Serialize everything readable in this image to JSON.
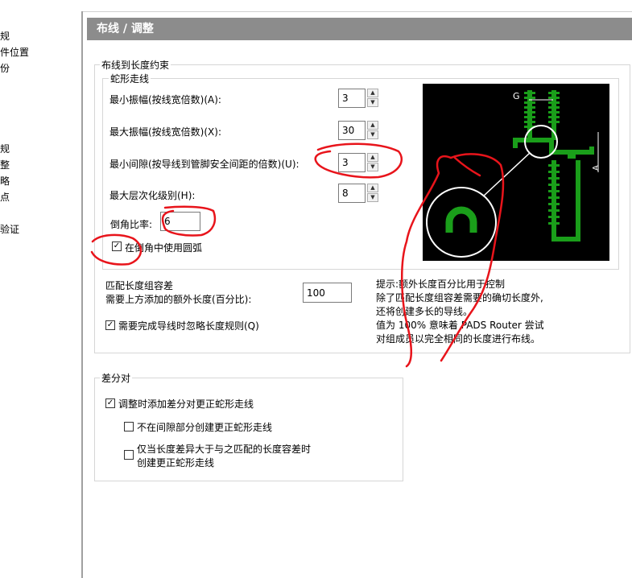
{
  "sidebar": {
    "items": [
      "规",
      "件位置",
      "份",
      "规",
      "整",
      "略",
      "点",
      "验证"
    ]
  },
  "page": {
    "title": "布线 / 调整"
  },
  "length_group": {
    "title": "布线到长度约束",
    "meander": {
      "title": "蛇形走线",
      "min_amplitude_label": "最小振幅(按线宽倍数)(A):",
      "min_amplitude_value": "3",
      "max_amplitude_label": "最大振幅(按线宽倍数)(X):",
      "max_amplitude_value": "30",
      "min_gap_label": "最小间隙(按导线到管脚安全间距的倍数)(U):",
      "min_gap_value": "3",
      "max_level_label": "最大层次化级别(H):",
      "max_level_value": "8",
      "chamfer_label": "倒角比率:",
      "chamfer_value": "6",
      "use_arc_label": "在倒角中使用圆弧",
      "use_arc_checked": true
    },
    "preview": {
      "label_g": "G",
      "label_a": "A"
    },
    "match_tolerance": {
      "line1": "匹配长度组容差",
      "line2": "需要上方添加的额外长度(百分比):",
      "value": "100"
    },
    "hint": {
      "line1": "提示:额外长度百分比用于控制",
      "line2": "除了匹配长度组容差需要的确切长度外,",
      "line3": "还将创建多长的导线。",
      "line4": "值为 100% 意味着 PADS Router 尝试",
      "line5": "对组成员以完全相同的长度进行布线。"
    },
    "ignore_rule_label": "需要完成导线时忽略长度规则(Q)",
    "ignore_rule_checked": true
  },
  "diff_pair": {
    "title": "差分对",
    "add_meander_label": "调整时添加差分对更正蛇形走线",
    "add_meander_checked": true,
    "no_gap_label": "不在间隙部分创建更正蛇形走线",
    "no_gap_checked": false,
    "only_when_line1": "仅当长度差异大于与之匹配的长度容差时",
    "only_when_line2": "创建更正蛇形走线",
    "only_when_checked": false
  },
  "colors": {
    "header_bg": "#8c8c8c",
    "preview_bg": "#000000",
    "trace_green": "#1a9e1a",
    "annotation_red": "#e8141b"
  }
}
